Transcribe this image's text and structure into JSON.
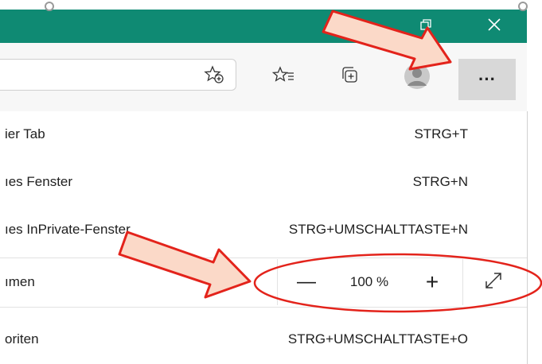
{
  "window": {
    "restore_icon": "restore-window-icon",
    "close_icon": "close-icon",
    "accent": "#0f8a73"
  },
  "toolbar": {
    "favorite_add_icon": "add-favorite-star-icon",
    "favorites_icon": "favorites-star-list-icon",
    "collections_icon": "collections-icon",
    "profile_icon": "profile-avatar-icon",
    "more_label": "···"
  },
  "menu": {
    "items": [
      {
        "label": "ier Tab",
        "shortcut": "STRG+T"
      },
      {
        "label": "ıes Fenster",
        "shortcut": "STRG+N"
      },
      {
        "label": "ıes InPrivate-Fenster",
        "shortcut": "STRG+UMSCHALTTASTE+N"
      },
      {
        "label": "ımen",
        "shortcut": ""
      },
      {
        "label": "oriten",
        "shortcut": "STRG+UMSCHALTTASTE+O"
      }
    ],
    "zoom": {
      "minus": "—",
      "value": "100 %",
      "plus": "+",
      "fullscreen_icon": "fullscreen-expand-icon"
    }
  },
  "annotations": {
    "arrow_color": "#e3231b",
    "arrow_fill": "#fbd9c8",
    "ellipse_color": "#e3231b"
  }
}
